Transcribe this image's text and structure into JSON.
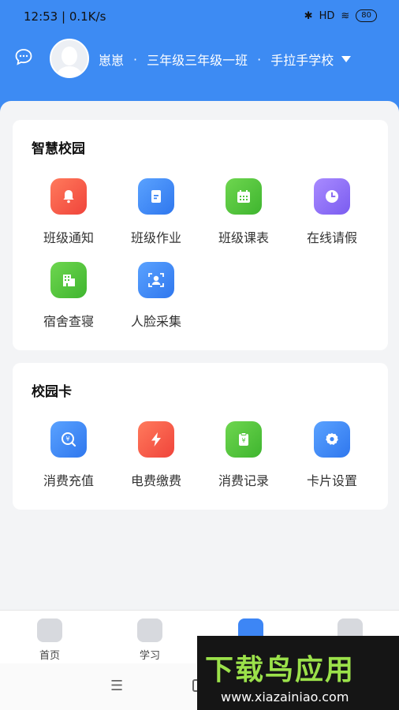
{
  "status_bar": {
    "time": "12:53 | 0.1K/s",
    "network": "HD",
    "battery": "80"
  },
  "header": {
    "user_name": "崽崽",
    "separator": "·",
    "class_name": "三年级三年级一班",
    "school": "手拉手学校"
  },
  "sections": [
    {
      "title": "智慧校园",
      "items": [
        {
          "label": "班级通知",
          "icon": "bell-icon",
          "color": "#f2533e"
        },
        {
          "label": "班级作业",
          "icon": "document-icon",
          "color": "#3d86f5"
        },
        {
          "label": "班级课表",
          "icon": "calendar-icon",
          "color": "#4fc43a"
        },
        {
          "label": "在线请假",
          "icon": "clock-icon",
          "color": "#8c6cf2"
        },
        {
          "label": "宿舍查寝",
          "icon": "building-icon",
          "color": "#4fc43a"
        },
        {
          "label": "人脸采集",
          "icon": "face-scan-icon",
          "color": "#3d86f5"
        }
      ]
    },
    {
      "title": "校园卡",
      "items": [
        {
          "label": "消费充值",
          "icon": "coin-search-icon",
          "color": "#3d86f5"
        },
        {
          "label": "电费缴费",
          "icon": "lightning-icon",
          "color": "#f2533e"
        },
        {
          "label": "消费记录",
          "icon": "receipt-icon",
          "color": "#4fc43a"
        },
        {
          "label": "卡片设置",
          "icon": "gear-icon",
          "color": "#3d86f5"
        }
      ]
    }
  ],
  "tabbar": [
    {
      "label": "首页",
      "icon": "home-icon"
    },
    {
      "label": "学习",
      "icon": "book-icon"
    },
    {
      "label": "",
      "icon": "school-icon"
    },
    {
      "label": "",
      "icon": "profile-icon"
    }
  ],
  "system_nav": {
    "menu_glyph": "☰"
  },
  "watermark": {
    "title": "下载鸟应用",
    "url": "www.xiazainiao.com"
  }
}
